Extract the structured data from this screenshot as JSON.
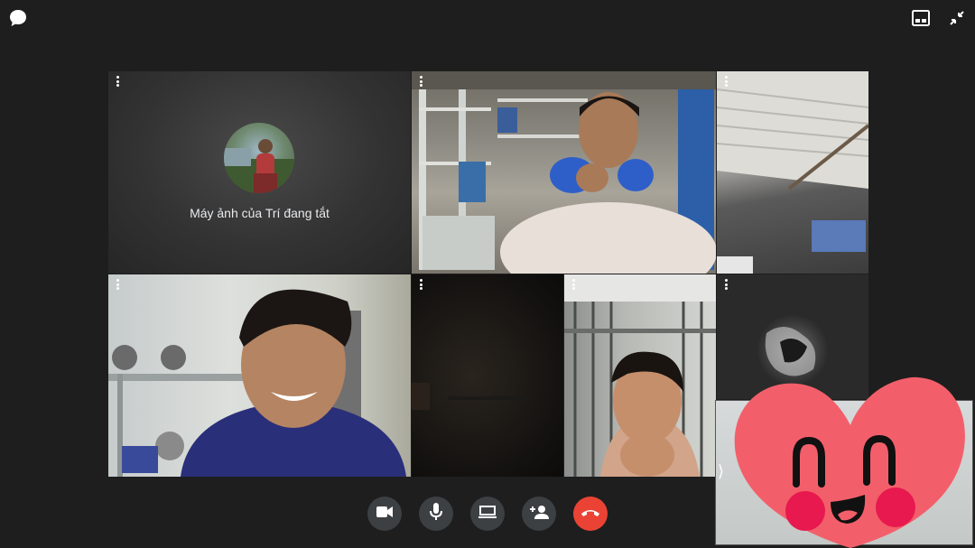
{
  "tiles": {
    "camera_off_text": "Máy ảnh của Trí đang tắt"
  },
  "controls": {
    "camera_icon": "videocam-icon",
    "mic_icon": "mic-icon",
    "share_icon": "present-screen-icon",
    "add_icon": "add-person-icon",
    "end_icon": "call-end-icon"
  },
  "top_bar": {
    "chat_icon": "chat-bubble-icon",
    "layout_icon": "layout-icon",
    "exit_fullscreen_icon": "exit-fullscreen-icon"
  },
  "colors": {
    "background": "#1e1e1e",
    "control_bg": "#3c4043",
    "end_call": "#ea4335",
    "sticker_heart": "#f25f6a",
    "sticker_cheek": "#e8194f"
  }
}
